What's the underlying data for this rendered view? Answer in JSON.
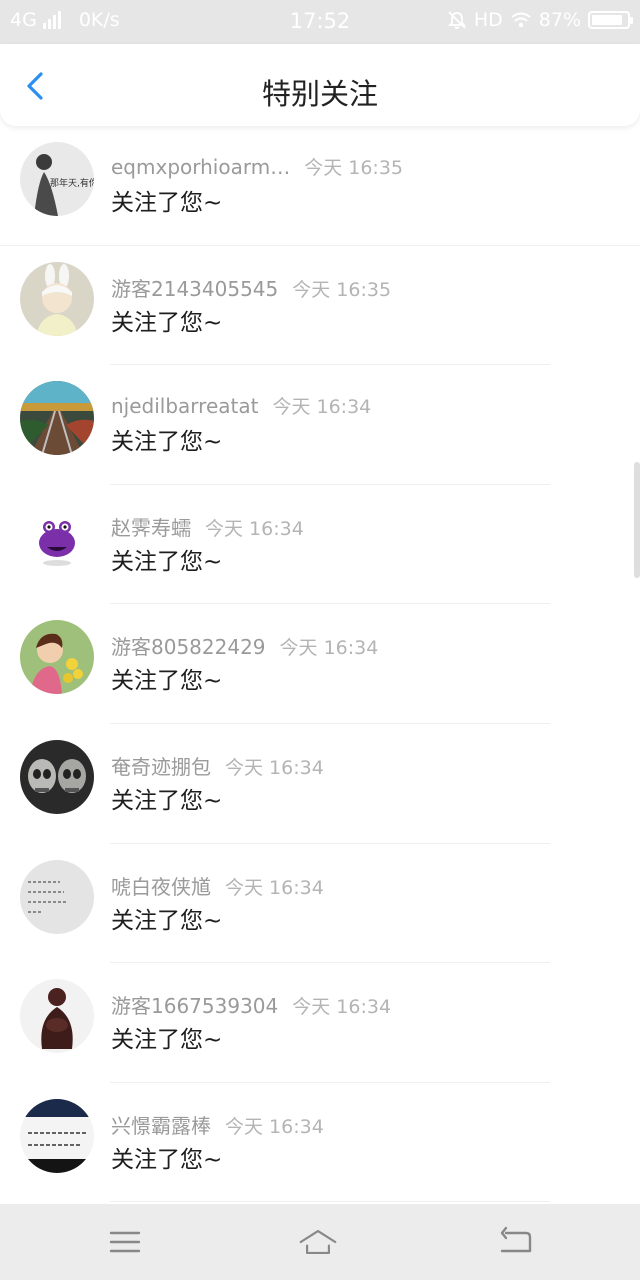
{
  "status_bar": {
    "network": "4G",
    "speed": "0K/s",
    "time": "17:52",
    "hd": "HD",
    "battery": "87%",
    "battery_level": 0.87
  },
  "header": {
    "title": "特别关注",
    "back_icon": "chevron-left-icon"
  },
  "items": [
    {
      "name": "eqmxporhioarm…",
      "time": "今天 16:35",
      "message": "关注了您~",
      "avatar": "avatar-text-girl"
    },
    {
      "name": "游客2143405545",
      "time": "今天 16:35",
      "message": "关注了您~",
      "avatar": "avatar-bunny-girl"
    },
    {
      "name": "njedilbarreatat",
      "time": "今天 16:34",
      "message": "关注了您~",
      "avatar": "avatar-railway"
    },
    {
      "name": "赵霁寿蠕",
      "time": "今天 16:34",
      "message": "关注了您~",
      "avatar": "avatar-purple-monster"
    },
    {
      "name": "游客805822429",
      "time": "今天 16:34",
      "message": "关注了您~",
      "avatar": "avatar-flower-girl"
    },
    {
      "name": "奄奇迹掤包",
      "time": "今天 16:34",
      "message": "关注了您~",
      "avatar": "avatar-skulls"
    },
    {
      "name": "唬白夜侠馗",
      "time": "今天 16:34",
      "message": "关注了您~",
      "avatar": "avatar-handwriting"
    },
    {
      "name": "游客1667539304",
      "time": "今天 16:34",
      "message": "关注了您~",
      "avatar": "avatar-statue"
    },
    {
      "name": "兴憬霸露棒",
      "time": "今天 16:34",
      "message": "关注了您~",
      "avatar": "avatar-calligraphy"
    }
  ],
  "nav": {
    "menu_icon": "menu-icon",
    "home_icon": "home-icon",
    "back_icon": "back-icon"
  },
  "colors": {
    "accent": "#2a8ef2",
    "name": "#9a9a9a",
    "time": "#b4b4b4"
  }
}
